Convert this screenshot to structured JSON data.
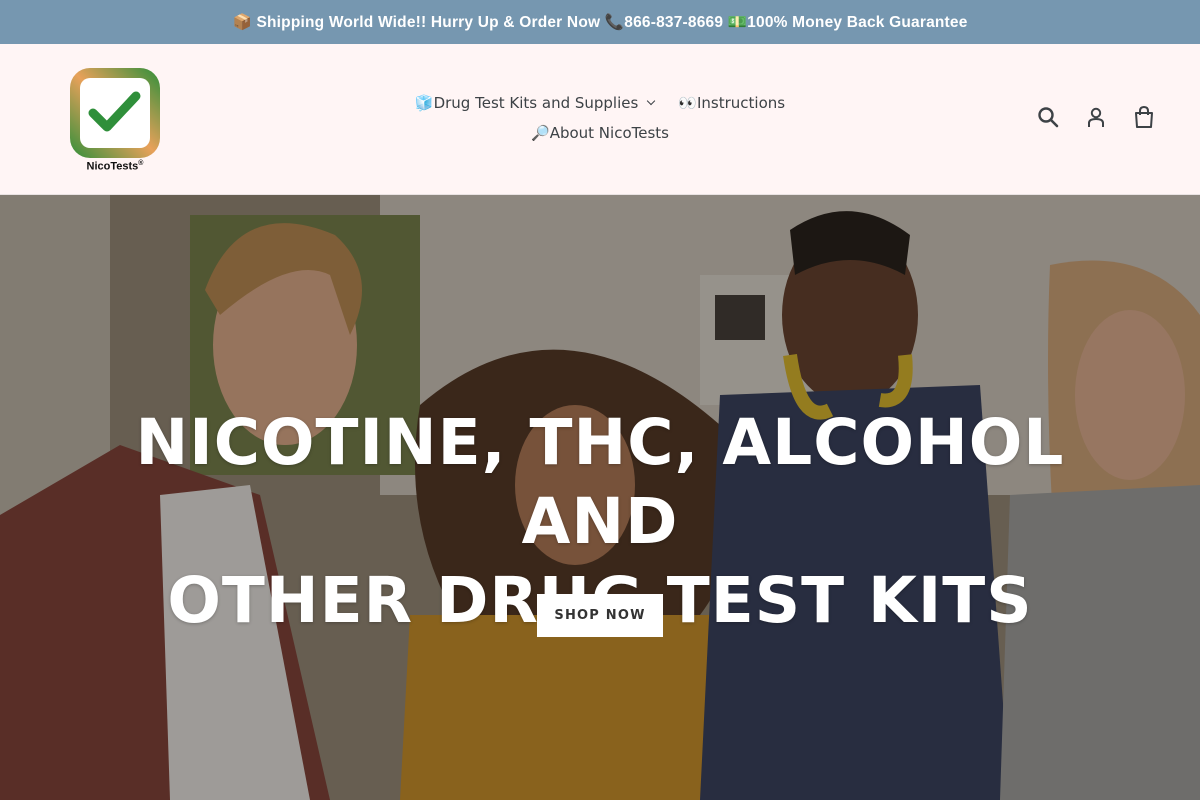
{
  "announcement": {
    "text": "📦 Shipping World Wide!! Hurry Up & Order Now 📞866-837-8669 💵100% Money Back Guarantee"
  },
  "header": {
    "logo_text": "NicoTests",
    "logo_mark": "®",
    "nav": [
      {
        "label": "🧊Drug Test Kits and Supplies"
      },
      {
        "label": "👀Instructions"
      },
      {
        "label": "🔎About NicoTests"
      }
    ],
    "icons": [
      "search-icon",
      "account-icon",
      "cart-icon"
    ]
  },
  "hero": {
    "heading_line1": "NICOTINE, THC, ALCOHOL AND",
    "heading_line2": "OTHER DRUG TEST KITS",
    "button_label": "SHOP NOW"
  },
  "colors": {
    "announcement_bg": "#7697b0",
    "header_bg": "#fff5f5",
    "logo_orange": "#e8a15a",
    "logo_green": "#2f8f3a"
  }
}
